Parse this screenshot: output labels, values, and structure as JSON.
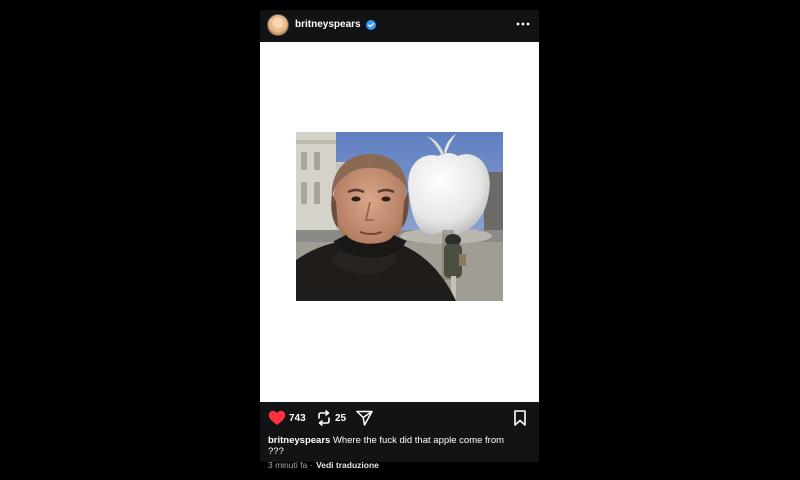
{
  "post": {
    "username": "britneyspears",
    "verified": true,
    "likes": "743",
    "reposts": "25",
    "caption_username": "britneyspears",
    "caption_text": "Where the fuck did that apple come from ???",
    "timestamp": "3 minuti fa",
    "separator": "·",
    "translate_label": "Vedi traduzione"
  },
  "icons": {
    "verified": "verified-badge-icon",
    "more": "more-options-icon",
    "like": "heart-icon",
    "repost": "repost-icon",
    "share": "send-icon",
    "save": "bookmark-icon"
  },
  "colors": {
    "like_active": "#ff3040",
    "verified_blue": "#3897f0"
  }
}
